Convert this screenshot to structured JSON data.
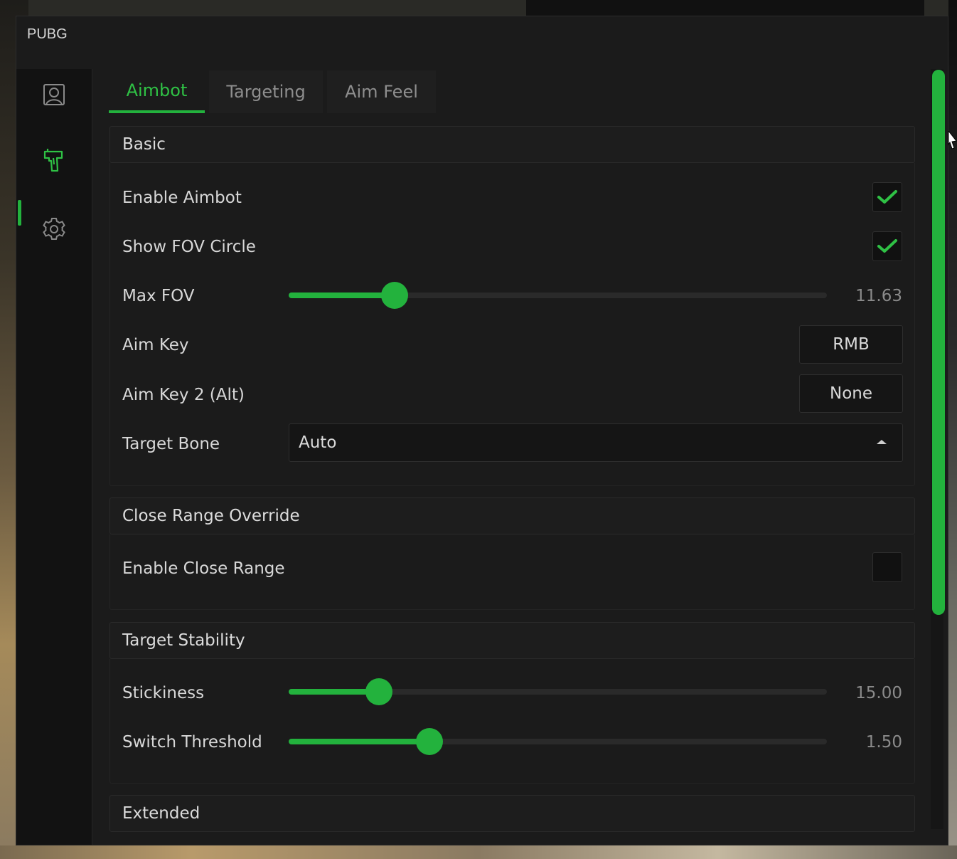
{
  "app": {
    "title": "PUBG"
  },
  "colors": {
    "accent": "#23b23d",
    "background": "#1b1b1b",
    "sidebar": "#121212"
  },
  "sidebar": {
    "items": [
      {
        "icon": "user-icon",
        "active": false
      },
      {
        "icon": "gun-icon",
        "active": true
      },
      {
        "icon": "gear-icon",
        "active": false
      }
    ]
  },
  "tabs": [
    {
      "label": "Aimbot",
      "active": true
    },
    {
      "label": "Targeting",
      "active": false
    },
    {
      "label": "Aim Feel",
      "active": false
    }
  ],
  "sections": {
    "basic": {
      "title": "Basic",
      "enable_aimbot": {
        "label": "Enable Aimbot",
        "checked": true
      },
      "show_fov_circle": {
        "label": "Show FOV Circle",
        "checked": true
      },
      "max_fov": {
        "label": "Max FOV",
        "value": "11.63",
        "fill_fraction": 0.197
      },
      "aim_key": {
        "label": "Aim Key",
        "value": "RMB"
      },
      "aim_key_2": {
        "label": "Aim Key 2 (Alt)",
        "value": "None"
      },
      "target_bone": {
        "label": "Target Bone",
        "value": "Auto"
      }
    },
    "close_range": {
      "title": "Close Range Override",
      "enable_close_range": {
        "label": "Enable Close Range",
        "checked": false
      }
    },
    "target_stability": {
      "title": "Target Stability",
      "stickiness": {
        "label": "Stickiness",
        "value": "15.00",
        "fill_fraction": 0.168
      },
      "switch_threshold": {
        "label": "Switch Threshold",
        "value": "1.50",
        "fill_fraction": 0.262
      }
    },
    "extended": {
      "title": "Extended"
    }
  },
  "scrollbar": {
    "thumb_fraction": 0.72
  }
}
